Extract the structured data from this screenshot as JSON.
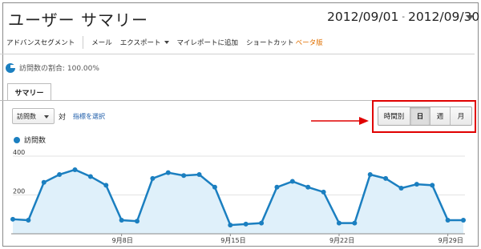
{
  "header": {
    "title": "ユーザー サマリー",
    "date_start": "2012/09/01",
    "date_sep": "-",
    "date_end": "2012/09/30"
  },
  "toolbar": {
    "advanced_segments": "アドバンスセグメント",
    "email": "メール",
    "export": "エクスポート",
    "add_to_dashboard": "マイレポートに追加",
    "shortcut": "ショートカット",
    "beta": "ベータ版"
  },
  "visits_percentage": "訪問数の割合: 100.00%",
  "tabs": {
    "summary": "サマリー"
  },
  "controls": {
    "metric": "訪問数",
    "vs": "対",
    "select_metric": "指標を選択"
  },
  "granularity": {
    "hourly": "時間別",
    "day": "日",
    "week": "週",
    "month": "月",
    "active": "day"
  },
  "colors": {
    "series": "#1b7fc0",
    "fill": "#dff0fa",
    "highlight": "#e00000"
  },
  "chart_data": {
    "type": "area",
    "series": [
      {
        "name": "訪問数",
        "x": [
          "9/1",
          "9/2",
          "9/3",
          "9/4",
          "9/5",
          "9/6",
          "9/7",
          "9/8",
          "9/9",
          "9/10",
          "9/11",
          "9/12",
          "9/13",
          "9/14",
          "9/15",
          "9/16",
          "9/17",
          "9/18",
          "9/19",
          "9/20",
          "9/21",
          "9/22",
          "9/23",
          "9/24",
          "9/25",
          "9/26",
          "9/27",
          "9/28",
          "9/29",
          "9/30"
        ],
        "values": [
          75,
          70,
          265,
          305,
          330,
          295,
          250,
          70,
          65,
          285,
          315,
          300,
          305,
          240,
          45,
          50,
          55,
          240,
          270,
          240,
          215,
          55,
          55,
          305,
          285,
          235,
          255,
          250,
          70,
          70
        ]
      }
    ],
    "xticks": [
      "9月8日",
      "9月15日",
      "9月22日",
      "9月29日"
    ],
    "yticks": [
      "400",
      "200"
    ],
    "ylim": [
      0,
      400
    ],
    "grid": true
  }
}
